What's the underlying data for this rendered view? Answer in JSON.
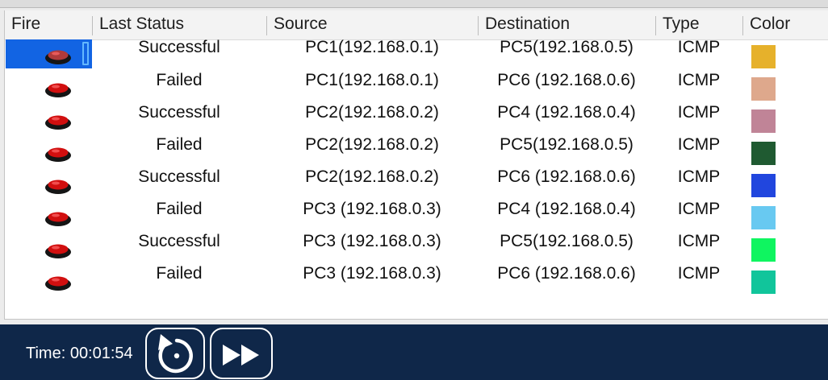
{
  "columns": {
    "fire": "Fire",
    "last_status": "Last Status",
    "source": "Source",
    "destination": "Destination",
    "type": "Type",
    "color": "Color"
  },
  "rows": [
    {
      "status": "Successful",
      "source": "PC1(192.168.0.1)",
      "destination": "PC5(192.168.0.5)",
      "type": "ICMP",
      "color": "#e6b12b",
      "selected": true
    },
    {
      "status": "Failed",
      "source": "PC1(192.168.0.1)",
      "destination": "PC6 (192.168.0.6)",
      "type": "ICMP",
      "color": "#dea88c",
      "selected": false
    },
    {
      "status": "Successful",
      "source": "PC2(192.168.0.2)",
      "destination": "PC4 (192.168.0.4)",
      "type": "ICMP",
      "color": "#c08497",
      "selected": false
    },
    {
      "status": "Failed",
      "source": "PC2(192.168.0.2)",
      "destination": "PC5(192.168.0.5)",
      "type": "ICMP",
      "color": "#1f5a31",
      "selected": false
    },
    {
      "status": "Successful",
      "source": "PC2(192.168.0.2)",
      "destination": "PC6 (192.168.0.6)",
      "type": "ICMP",
      "color": "#2146de",
      "selected": false
    },
    {
      "status": "Failed",
      "source": "PC3 (192.168.0.3)",
      "destination": "PC4 (192.168.0.4)",
      "type": "ICMP",
      "color": "#68c9f1",
      "selected": false
    },
    {
      "status": "Successful",
      "source": "PC3 (192.168.0.3)",
      "destination": "PC5(192.168.0.5)",
      "type": "ICMP",
      "color": "#0ff560",
      "selected": false
    },
    {
      "status": "Failed",
      "source": "PC3 (192.168.0.3)",
      "destination": "PC6 (192.168.0.6)",
      "type": "ICMP",
      "color": "#11c59b",
      "selected": false
    }
  ],
  "icons": {
    "fire": "red-fire-button-icon",
    "reset": "reset-simulation-icon",
    "fast_forward": "fast-forward-icon"
  },
  "colors": {
    "selection": "#1264e3",
    "bottom_bar": "#0f2749",
    "fire_button": "#d10f0f"
  },
  "footer": {
    "time": "Time: 00:01:54"
  }
}
